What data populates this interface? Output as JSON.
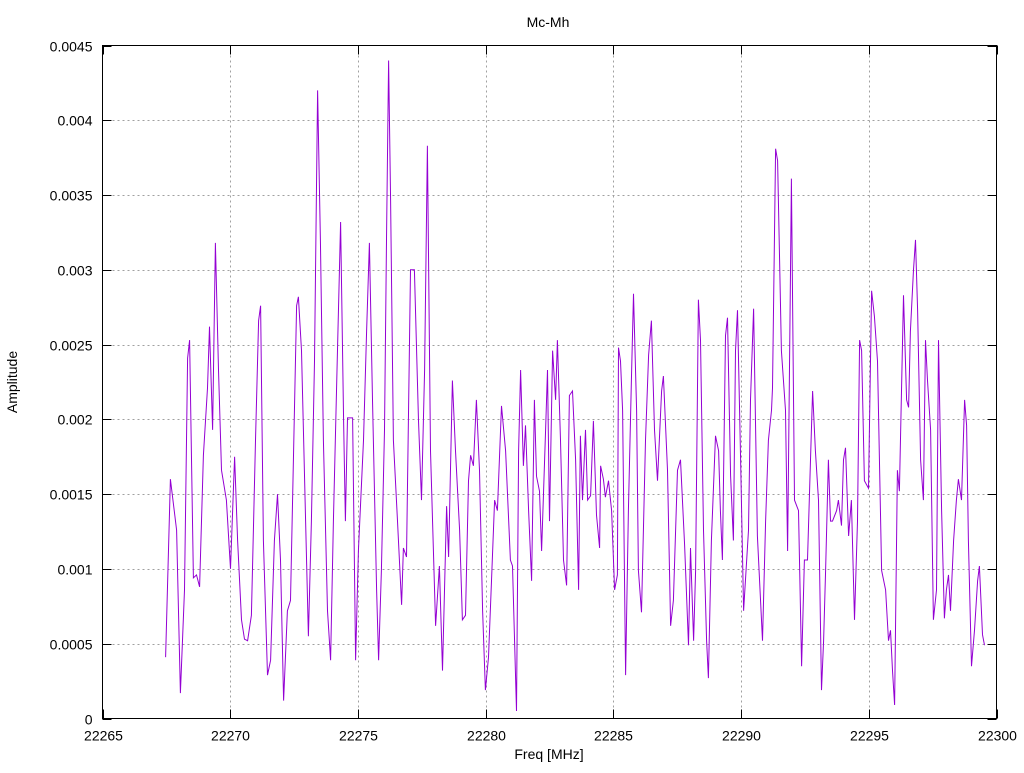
{
  "chart_data": {
    "type": "line",
    "title": "Mc-Mh",
    "xlabel": "Freq [MHz]",
    "ylabel": "Amplitude",
    "xlim": [
      22265,
      22300
    ],
    "ylim": [
      0,
      0.0045
    ],
    "xticks": [
      "22265",
      "22270",
      "22275",
      "22280",
      "22285",
      "22290",
      "22295",
      "22300"
    ],
    "xtick_values": [
      22265,
      22270,
      22275,
      22280,
      22285,
      22290,
      22295,
      22300
    ],
    "yticks": [
      "0",
      "0.0005",
      "0.001",
      "0.0015",
      "0.002",
      "0.0025",
      "0.003",
      "0.0035",
      "0.004",
      "0.0045"
    ],
    "ytick_values": [
      0,
      0.0005,
      0.001,
      0.0015,
      0.002,
      0.0025,
      0.003,
      0.0035,
      0.004,
      0.0045
    ],
    "grid": true,
    "legend": "none",
    "series": [
      {
        "name": "Mc-Mh",
        "color": "#9400d3",
        "points": [
          [
            22267.47,
            0.00041
          ],
          [
            22267.66,
            0.0016
          ],
          [
            22267.9,
            0.00126
          ],
          [
            22268.05,
            0.00017
          ],
          [
            22268.21,
            0.00086
          ],
          [
            22268.33,
            0.00241
          ],
          [
            22268.41,
            0.00253
          ],
          [
            22268.56,
            0.00094
          ],
          [
            22268.68,
            0.00096
          ],
          [
            22268.8,
            0.00088
          ],
          [
            22268.95,
            0.00176
          ],
          [
            22269.11,
            0.00221
          ],
          [
            22269.19,
            0.00262
          ],
          [
            22269.31,
            0.00193
          ],
          [
            22269.42,
            0.00318
          ],
          [
            22269.54,
            0.00233
          ],
          [
            22269.66,
            0.00166
          ],
          [
            22269.85,
            0.00146
          ],
          [
            22270.01,
            0.001
          ],
          [
            22270.17,
            0.00175
          ],
          [
            22270.29,
            0.00119
          ],
          [
            22270.44,
            0.00066
          ],
          [
            22270.56,
            0.00053
          ],
          [
            22270.68,
            0.00052
          ],
          [
            22270.83,
            0.00069
          ],
          [
            22270.99,
            0.00186
          ],
          [
            22271.11,
            0.00266
          ],
          [
            22271.19,
            0.00276
          ],
          [
            22271.3,
            0.00119
          ],
          [
            22271.46,
            0.00029
          ],
          [
            22271.58,
            0.00039
          ],
          [
            22271.73,
            0.00119
          ],
          [
            22271.85,
            0.0015
          ],
          [
            22271.97,
            0.00106
          ],
          [
            22272.09,
            0.00012
          ],
          [
            22272.24,
            0.00072
          ],
          [
            22272.36,
            0.00079
          ],
          [
            22272.48,
            0.00179
          ],
          [
            22272.6,
            0.00276
          ],
          [
            22272.67,
            0.00282
          ],
          [
            22272.79,
            0.00246
          ],
          [
            22272.95,
            0.00132
          ],
          [
            22273.06,
            0.00055
          ],
          [
            22273.18,
            0.00132
          ],
          [
            22273.3,
            0.00239
          ],
          [
            22273.42,
            0.0042
          ],
          [
            22273.53,
            0.0032
          ],
          [
            22273.65,
            0.00186
          ],
          [
            22273.81,
            0.00072
          ],
          [
            22273.93,
            0.00039
          ],
          [
            22274.04,
            0.00132
          ],
          [
            22274.16,
            0.00219
          ],
          [
            22274.32,
            0.00332
          ],
          [
            22274.44,
            0.00199
          ],
          [
            22274.51,
            0.00132
          ],
          [
            22274.59,
            0.00201
          ],
          [
            22274.79,
            0.00201
          ],
          [
            22274.91,
            0.00039
          ],
          [
            22275.02,
            0.00112
          ],
          [
            22275.22,
            0.00186
          ],
          [
            22275.34,
            0.00259
          ],
          [
            22275.45,
            0.00318
          ],
          [
            22275.57,
            0.00213
          ],
          [
            22275.73,
            0.00086
          ],
          [
            22275.81,
            0.00039
          ],
          [
            22275.92,
            0.00099
          ],
          [
            22276.04,
            0.00193
          ],
          [
            22276.12,
            0.0032
          ],
          [
            22276.2,
            0.0044
          ],
          [
            22276.28,
            0.00346
          ],
          [
            22276.39,
            0.00186
          ],
          [
            22276.55,
            0.00132
          ],
          [
            22276.71,
            0.00076
          ],
          [
            22276.78,
            0.00114
          ],
          [
            22276.9,
            0.00108
          ],
          [
            22277.06,
            0.003
          ],
          [
            22277.21,
            0.003
          ],
          [
            22277.37,
            0.00199
          ],
          [
            22277.49,
            0.00146
          ],
          [
            22277.61,
            0.00233
          ],
          [
            22277.72,
            0.00383
          ],
          [
            22277.84,
            0.00179
          ],
          [
            22278.04,
            0.00062
          ],
          [
            22278.19,
            0.00102
          ],
          [
            22278.31,
            0.00032
          ],
          [
            22278.47,
            0.00142
          ],
          [
            22278.55,
            0.00108
          ],
          [
            22278.7,
            0.00226
          ],
          [
            22278.82,
            0.00179
          ],
          [
            22278.98,
            0.00126
          ],
          [
            22279.09,
            0.00066
          ],
          [
            22279.21,
            0.00069
          ],
          [
            22279.33,
            0.00159
          ],
          [
            22279.41,
            0.00176
          ],
          [
            22279.52,
            0.00169
          ],
          [
            22279.64,
            0.00213
          ],
          [
            22279.76,
            0.00166
          ],
          [
            22279.88,
            0.00072
          ],
          [
            22279.99,
            0.00019
          ],
          [
            22280.11,
            0.00041
          ],
          [
            22280.23,
            0.00092
          ],
          [
            22280.35,
            0.00146
          ],
          [
            22280.46,
            0.00139
          ],
          [
            22280.62,
            0.00209
          ],
          [
            22280.78,
            0.00179
          ],
          [
            22280.97,
            0.00106
          ],
          [
            22281.05,
            0.00102
          ],
          [
            22281.21,
            5e-05
          ],
          [
            22281.29,
            0.00179
          ],
          [
            22281.37,
            0.00233
          ],
          [
            22281.48,
            0.00169
          ],
          [
            22281.56,
            0.00196
          ],
          [
            22281.68,
            0.00139
          ],
          [
            22281.8,
            0.00092
          ],
          [
            22281.91,
            0.00213
          ],
          [
            22281.99,
            0.00162
          ],
          [
            22282.11,
            0.00152
          ],
          [
            22282.19,
            0.00112
          ],
          [
            22282.34,
            0.00189
          ],
          [
            22282.42,
            0.00233
          ],
          [
            22282.5,
            0.00132
          ],
          [
            22282.62,
            0.00246
          ],
          [
            22282.74,
            0.00213
          ],
          [
            22282.81,
            0.00253
          ],
          [
            22282.93,
            0.00186
          ],
          [
            22283.05,
            0.00106
          ],
          [
            22283.17,
            0.00089
          ],
          [
            22283.28,
            0.00216
          ],
          [
            22283.4,
            0.00219
          ],
          [
            22283.52,
            0.00173
          ],
          [
            22283.64,
            0.00086
          ],
          [
            22283.71,
            0.00189
          ],
          [
            22283.79,
            0.00146
          ],
          [
            22283.91,
            0.00193
          ],
          [
            22283.99,
            0.00146
          ],
          [
            22284.11,
            0.00149
          ],
          [
            22284.22,
            0.00199
          ],
          [
            22284.34,
            0.00136
          ],
          [
            22284.46,
            0.00114
          ],
          [
            22284.5,
            0.00169
          ],
          [
            22284.61,
            0.0016
          ],
          [
            22284.69,
            0.00148
          ],
          [
            22284.81,
            0.00159
          ],
          [
            22284.93,
            0.00139
          ],
          [
            22285.05,
            0.00086
          ],
          [
            22285.16,
            0.00096
          ],
          [
            22285.2,
            0.00248
          ],
          [
            22285.28,
            0.00239
          ],
          [
            22285.36,
            0.00206
          ],
          [
            22285.48,
            0.00029
          ],
          [
            22285.59,
            0.00139
          ],
          [
            22285.71,
            0.00229
          ],
          [
            22285.79,
            0.00284
          ],
          [
            22285.91,
            0.00206
          ],
          [
            22285.98,
            0.00099
          ],
          [
            22286.1,
            0.00071
          ],
          [
            22286.26,
            0.00186
          ],
          [
            22286.38,
            0.00243
          ],
          [
            22286.49,
            0.00266
          ],
          [
            22286.61,
            0.00193
          ],
          [
            22286.73,
            0.00159
          ],
          [
            22286.89,
            0.00219
          ],
          [
            22286.96,
            0.00229
          ],
          [
            22287.12,
            0.00166
          ],
          [
            22287.24,
            0.00062
          ],
          [
            22287.35,
            0.00079
          ],
          [
            22287.51,
            0.00166
          ],
          [
            22287.63,
            0.00173
          ],
          [
            22287.79,
            0.00116
          ],
          [
            22287.94,
            0.00049
          ],
          [
            22288.02,
            0.00114
          ],
          [
            22288.14,
            0.00052
          ],
          [
            22288.22,
            0.00099
          ],
          [
            22288.33,
            0.0028
          ],
          [
            22288.41,
            0.00253
          ],
          [
            22288.53,
            0.00126
          ],
          [
            22288.65,
            0.00052
          ],
          [
            22288.72,
            0.00027
          ],
          [
            22288.84,
            0.00119
          ],
          [
            22289.0,
            0.00189
          ],
          [
            22289.12,
            0.00179
          ],
          [
            22289.19,
            0.00139
          ],
          [
            22289.27,
            0.00106
          ],
          [
            22289.39,
            0.00256
          ],
          [
            22289.47,
            0.00268
          ],
          [
            22289.59,
            0.00162
          ],
          [
            22289.7,
            0.00119
          ],
          [
            22289.78,
            0.00246
          ],
          [
            22289.86,
            0.00273
          ],
          [
            22289.98,
            0.00173
          ],
          [
            22290.1,
            0.00072
          ],
          [
            22290.29,
            0.00126
          ],
          [
            22290.37,
            0.00213
          ],
          [
            22290.49,
            0.00274
          ],
          [
            22290.64,
            0.00122
          ],
          [
            22290.84,
            0.00052
          ],
          [
            22290.96,
            0.00132
          ],
          [
            22291.07,
            0.00186
          ],
          [
            22291.19,
            0.00206
          ],
          [
            22291.23,
            0.00221
          ],
          [
            22291.35,
            0.00381
          ],
          [
            22291.43,
            0.00373
          ],
          [
            22291.58,
            0.00246
          ],
          [
            22291.74,
            0.00206
          ],
          [
            22291.82,
            0.00112
          ],
          [
            22291.94,
            0.00306
          ],
          [
            22291.97,
            0.00361
          ],
          [
            22292.09,
            0.00146
          ],
          [
            22292.25,
            0.00139
          ],
          [
            22292.37,
            0.00035
          ],
          [
            22292.48,
            0.00106
          ],
          [
            22292.6,
            0.00106
          ],
          [
            22292.72,
            0.00173
          ],
          [
            22292.8,
            0.00219
          ],
          [
            22292.91,
            0.00179
          ],
          [
            22293.03,
            0.00146
          ],
          [
            22293.15,
            0.00019
          ],
          [
            22293.23,
            0.00052
          ],
          [
            22293.31,
            0.00099
          ],
          [
            22293.42,
            0.00173
          ],
          [
            22293.5,
            0.00132
          ],
          [
            22293.58,
            0.00132
          ],
          [
            22293.74,
            0.00139
          ],
          [
            22293.81,
            0.00146
          ],
          [
            22293.93,
            0.00129
          ],
          [
            22294.01,
            0.00173
          ],
          [
            22294.09,
            0.00181
          ],
          [
            22294.21,
            0.00122
          ],
          [
            22294.32,
            0.00146
          ],
          [
            22294.44,
            0.00066
          ],
          [
            22294.56,
            0.00132
          ],
          [
            22294.64,
            0.00253
          ],
          [
            22294.72,
            0.00246
          ],
          [
            22294.83,
            0.00159
          ],
          [
            22294.99,
            0.00154
          ],
          [
            22295.11,
            0.00286
          ],
          [
            22295.22,
            0.00269
          ],
          [
            22295.34,
            0.00239
          ],
          [
            22295.5,
            0.00099
          ],
          [
            22295.66,
            0.00086
          ],
          [
            22295.77,
            0.00052
          ],
          [
            22295.85,
            0.00059
          ],
          [
            22295.93,
            0.00032
          ],
          [
            22296.01,
            9e-05
          ],
          [
            22296.12,
            0.00166
          ],
          [
            22296.2,
            0.00152
          ],
          [
            22296.36,
            0.00283
          ],
          [
            22296.48,
            0.00213
          ],
          [
            22296.56,
            0.00208
          ],
          [
            22296.63,
            0.00259
          ],
          [
            22296.75,
            0.003
          ],
          [
            22296.83,
            0.0032
          ],
          [
            22296.91,
            0.00273
          ],
          [
            22297.03,
            0.00173
          ],
          [
            22297.14,
            0.00146
          ],
          [
            22297.22,
            0.00253
          ],
          [
            22297.3,
            0.00226
          ],
          [
            22297.42,
            0.00193
          ],
          [
            22297.53,
            0.00066
          ],
          [
            22297.65,
            0.00086
          ],
          [
            22297.73,
            0.00253
          ],
          [
            22297.85,
            0.00139
          ],
          [
            22297.96,
            0.00067
          ],
          [
            22298.04,
            0.00086
          ],
          [
            22298.12,
            0.00096
          ],
          [
            22298.2,
            0.00072
          ],
          [
            22298.32,
            0.00119
          ],
          [
            22298.43,
            0.00146
          ],
          [
            22298.51,
            0.0016
          ],
          [
            22298.63,
            0.00146
          ],
          [
            22298.75,
            0.00213
          ],
          [
            22298.83,
            0.00196
          ],
          [
            22298.9,
            0.00119
          ],
          [
            22299.02,
            0.00035
          ],
          [
            22299.14,
            0.00059
          ],
          [
            22299.26,
            0.00092
          ],
          [
            22299.33,
            0.00102
          ],
          [
            22299.45,
            0.00056
          ],
          [
            22299.53,
            0.00049
          ]
        ]
      }
    ]
  }
}
